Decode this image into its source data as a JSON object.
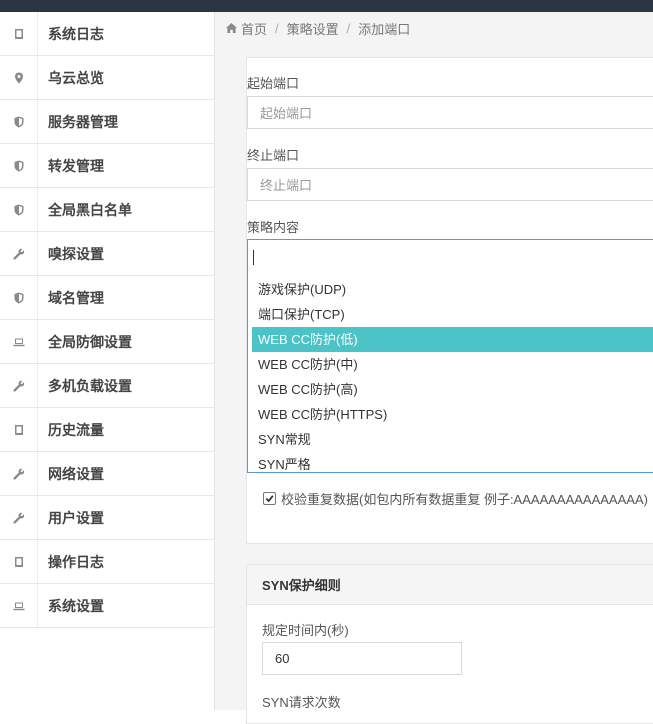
{
  "sidebar": {
    "items": [
      {
        "label": "系统日志",
        "icon": "book-icon"
      },
      {
        "label": "乌云总览",
        "icon": "map-marker-icon"
      },
      {
        "label": "服务器管理",
        "icon": "shield-icon"
      },
      {
        "label": "转发管理",
        "icon": "shield-icon"
      },
      {
        "label": "全局黑白名单",
        "icon": "shield-icon"
      },
      {
        "label": "嗅探设置",
        "icon": "wrench-icon"
      },
      {
        "label": "域名管理",
        "icon": "shield-icon"
      },
      {
        "label": "全局防御设置",
        "icon": "laptop-icon"
      },
      {
        "label": "多机负载设置",
        "icon": "wrench-icon"
      },
      {
        "label": "历史流量",
        "icon": "book-icon"
      },
      {
        "label": "网络设置",
        "icon": "wrench-icon"
      },
      {
        "label": "用户设置",
        "icon": "wrench-icon"
      },
      {
        "label": "操作日志",
        "icon": "book-icon"
      },
      {
        "label": "系统设置",
        "icon": "laptop-icon"
      }
    ]
  },
  "breadcrumb": {
    "home": "首页",
    "sep": "/",
    "level2": "策略设置",
    "level3": "添加端口"
  },
  "form": {
    "start_port": {
      "label": "起始端口",
      "placeholder": "起始端口"
    },
    "end_port": {
      "label": "终止端口",
      "placeholder": "终止端口"
    },
    "policy": {
      "label": "策略内容",
      "options": [
        "游戏保护(UDP)",
        "端口保护(TCP)",
        "WEB CC防护(低)",
        "WEB CC防护(中)",
        "WEB CC防护(高)",
        "WEB CC防护(HTTPS)",
        "SYN常规",
        "SYN严格"
      ],
      "selected_index": 2
    },
    "check_duplicate": {
      "label": "校验重复数据(如包内所有数据重复 例子:AAAAAAAAAAAAAAA)",
      "checked": true
    }
  },
  "syn_section": {
    "title": "SYN保护细则",
    "time_label": "规定时间内(秒)",
    "time_value": "60",
    "count_label": "SYN请求次数"
  },
  "colors": {
    "highlight": "#4cc3c6",
    "focus_border": "#5b9bd5",
    "topbar": "#2b3643"
  }
}
